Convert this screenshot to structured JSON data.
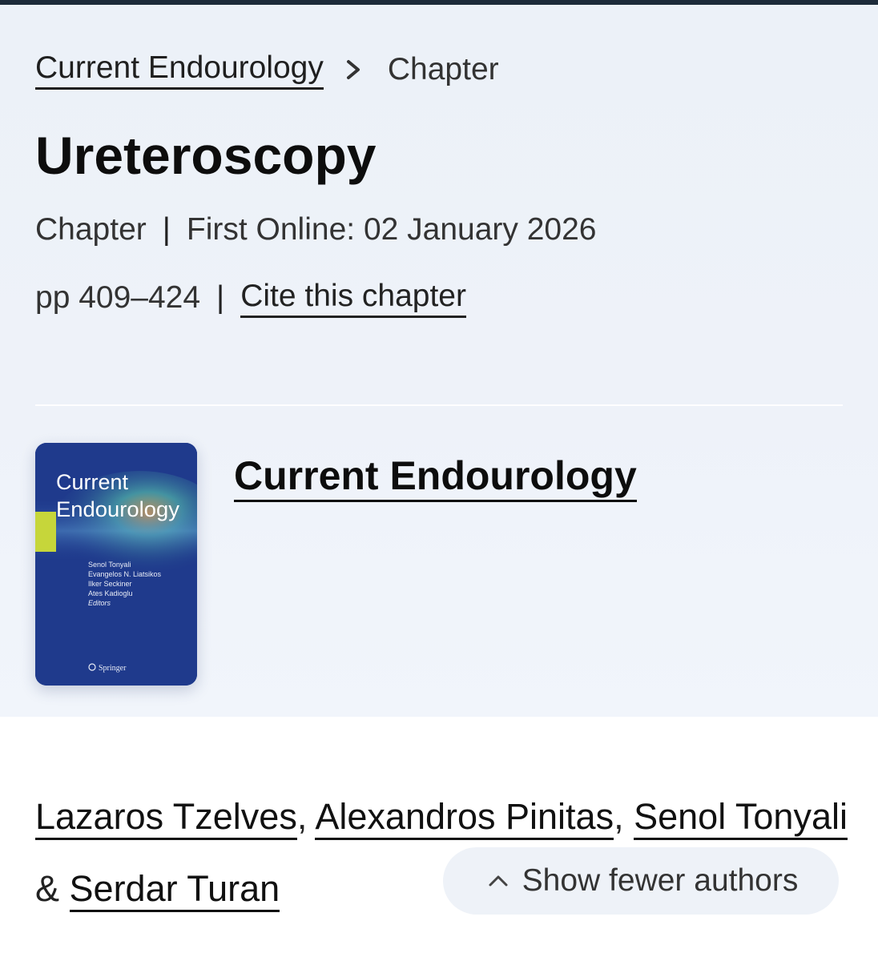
{
  "breadcrumb": {
    "book_label": "Current Endourology",
    "separator_icon": "chevron-right-icon",
    "current_label": "Chapter"
  },
  "chapter": {
    "title": "Ureteroscopy",
    "type_label": "Chapter",
    "separator": "|",
    "first_online": "First Online: 02 January 2026",
    "pages": "pp 409–424",
    "cite_label": "Cite this chapter"
  },
  "book": {
    "title": "Current Endourology",
    "cover": {
      "title_line1": "Current",
      "title_line2": "Endourology",
      "editors": [
        "Senol Tonyali",
        "Evangelos N. Liatsikos",
        "Ilker Seckiner",
        "Ates Kadioglu"
      ],
      "editors_label": "Editors",
      "publisher": "Springer",
      "publisher_icon": "springer-horse-icon",
      "background_color": "#1f3a8c",
      "accent_color": "#c6d63a"
    }
  },
  "authors": {
    "list": [
      "Lazaros Tzelves",
      "Alexandros Pinitas",
      "Senol Tonyali",
      "Serdar Turan"
    ],
    "comma": ",",
    "ampersand": "&",
    "toggle_label": "Show fewer authors",
    "toggle_icon": "chevron-up-icon"
  },
  "colors": {
    "top_rule": "#1d2b3a",
    "hero_background": "#eef2f9",
    "toggle_background": "#eef2f8"
  }
}
